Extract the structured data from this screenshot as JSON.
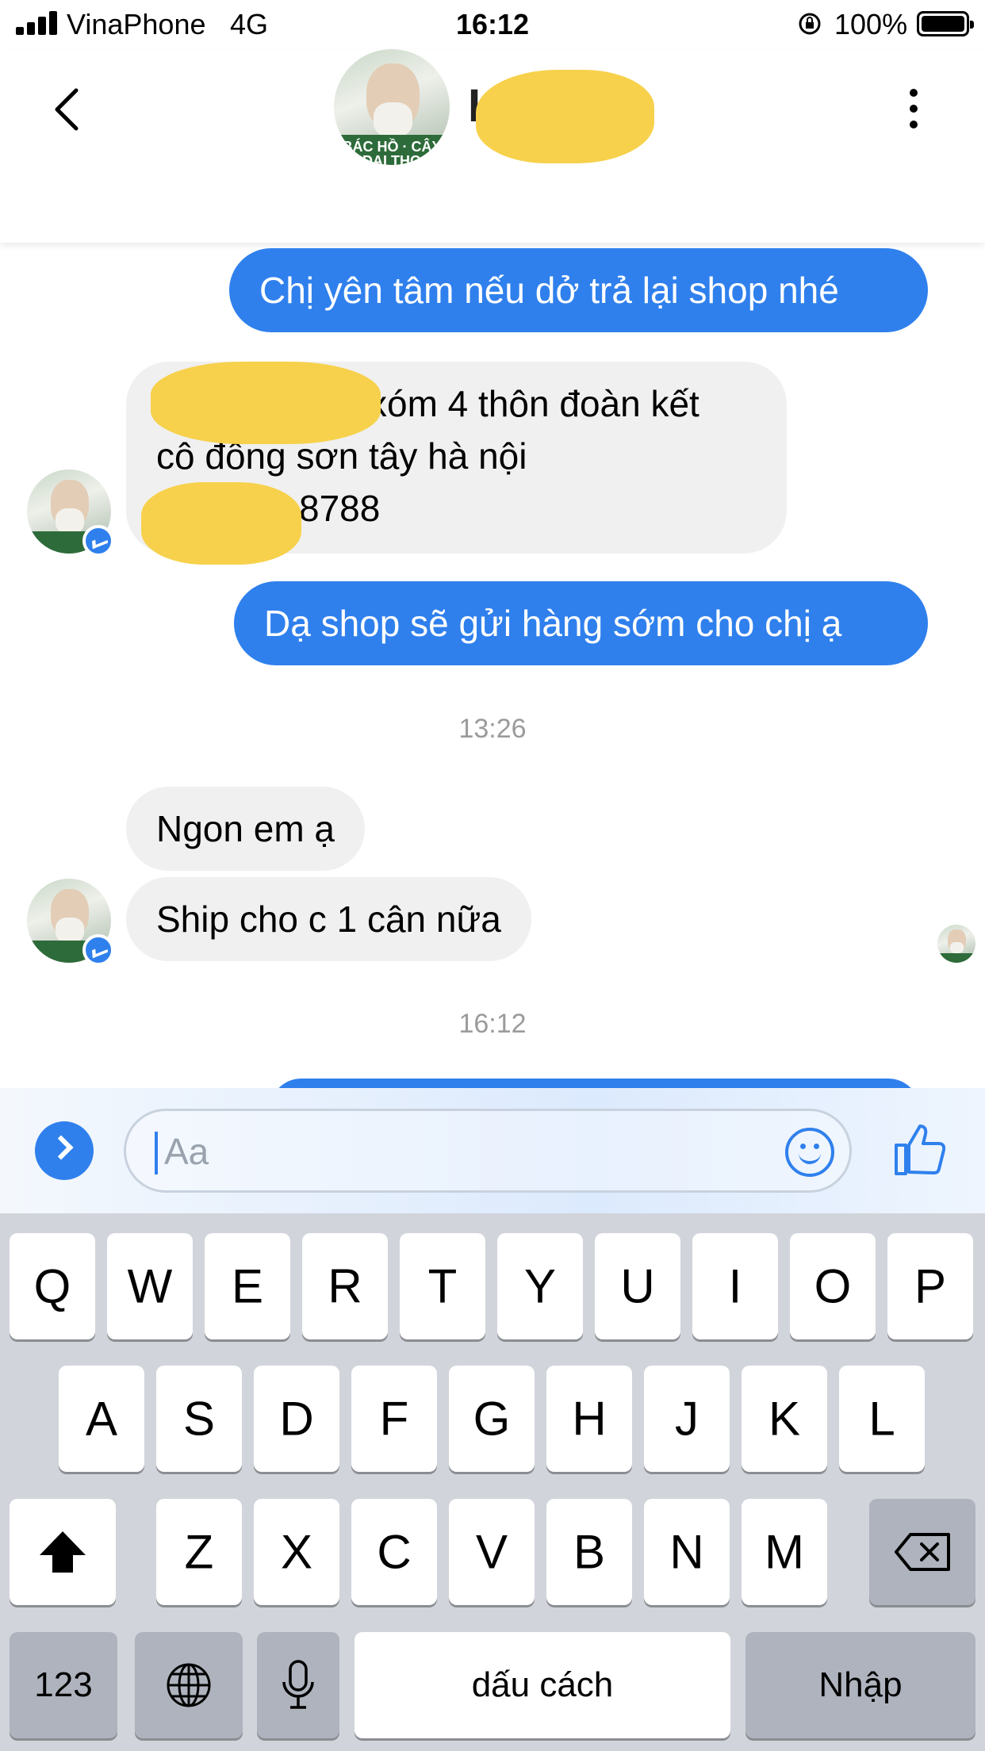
{
  "status_bar": {
    "carrier": "VinaPhone",
    "network": "4G",
    "time": "16:12",
    "battery": "100%"
  },
  "header": {
    "contact_name": "K",
    "avatar_caption": "BÁC HỒ · CÂY ĐẠI THỌ"
  },
  "messages": [
    {
      "type": "out",
      "text": "Chị yên tâm nếu dở trả lại shop nhé"
    },
    {
      "type": "in",
      "lines": [
        "xóm 4 thôn đoàn kết",
        "cô đông sơn tây hà nội",
        "8788"
      ]
    },
    {
      "type": "out",
      "text": "Dạ shop sẽ gửi hàng sớm cho chị ạ"
    },
    {
      "type": "timestamp",
      "text": "13:26"
    },
    {
      "type": "in",
      "text": "Ngon em ạ"
    },
    {
      "type": "in",
      "text": "Ship cho c 1 cân nữa"
    },
    {
      "type": "timestamp",
      "text": "16:12"
    }
  ],
  "composer": {
    "placeholder": "Aa"
  },
  "keyboard": {
    "row1": [
      "Q",
      "W",
      "E",
      "R",
      "T",
      "Y",
      "U",
      "I",
      "O",
      "P"
    ],
    "row2": [
      "A",
      "S",
      "D",
      "F",
      "G",
      "H",
      "J",
      "K",
      "L"
    ],
    "row3": [
      "Z",
      "X",
      "C",
      "V",
      "B",
      "N",
      "M"
    ],
    "numbers_key": "123",
    "space_key": "dấu cách",
    "return_key": "Nhập"
  },
  "icons": [
    "back-icon",
    "more-icon",
    "messenger-badge-icon",
    "expand-icon",
    "emoji-icon",
    "like-icon",
    "shift-icon",
    "backspace-icon",
    "globe-icon",
    "mic-icon"
  ],
  "colors": {
    "accent": "#2f80ed",
    "incoming_bubble": "#f0f0f0",
    "keyboard_bg": "#d1d4da"
  }
}
